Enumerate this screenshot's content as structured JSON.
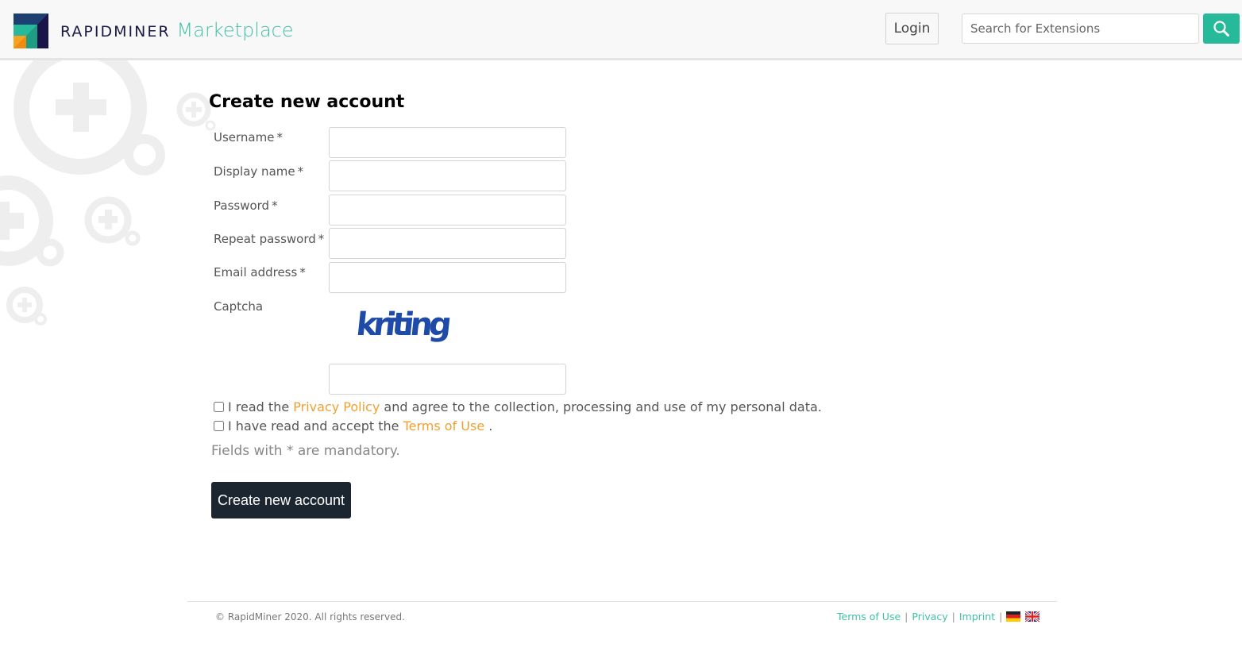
{
  "header": {
    "brand_main": "RAPIDMINER",
    "brand_sub": "Marketplace",
    "login_label": "Login",
    "search_placeholder": "Search for Extensions",
    "search_icon": "search-icon"
  },
  "form": {
    "title": "Create new account",
    "required_mark": "*",
    "fields": [
      {
        "label": "Username",
        "required": true,
        "value": ""
      },
      {
        "label": "Display name",
        "required": true,
        "value": ""
      },
      {
        "label": "Password",
        "required": true,
        "value": ""
      },
      {
        "label": "Repeat password",
        "required": true,
        "value": ""
      },
      {
        "label": "Email address",
        "required": true,
        "value": ""
      }
    ],
    "captcha_label": "Captcha",
    "captcha_text": "kriting",
    "captcha_value": "",
    "privacy": {
      "prefix": "I read the",
      "link": "Privacy Policy",
      "suffix": "and agree to the collection, processing and use of my personal data.",
      "checked": false
    },
    "terms": {
      "prefix": "I have read and accept the",
      "link": "Terms of Use",
      "suffix": ".",
      "checked": false
    },
    "mandatory_note": "Fields with * are mandatory.",
    "submit_label": "Create new account"
  },
  "footer": {
    "copyright": "© RapidMiner 2020. All rights reserved.",
    "links": [
      "Terms of Use",
      "Privacy",
      "Imprint"
    ],
    "separator": "|",
    "languages": [
      "german-flag-icon",
      "uk-flag-icon"
    ]
  },
  "colors": {
    "accent": "#26b99a",
    "brand_text": "#1b1a44",
    "link_orange": "#f0a030",
    "button_dark": "#1c2631"
  }
}
